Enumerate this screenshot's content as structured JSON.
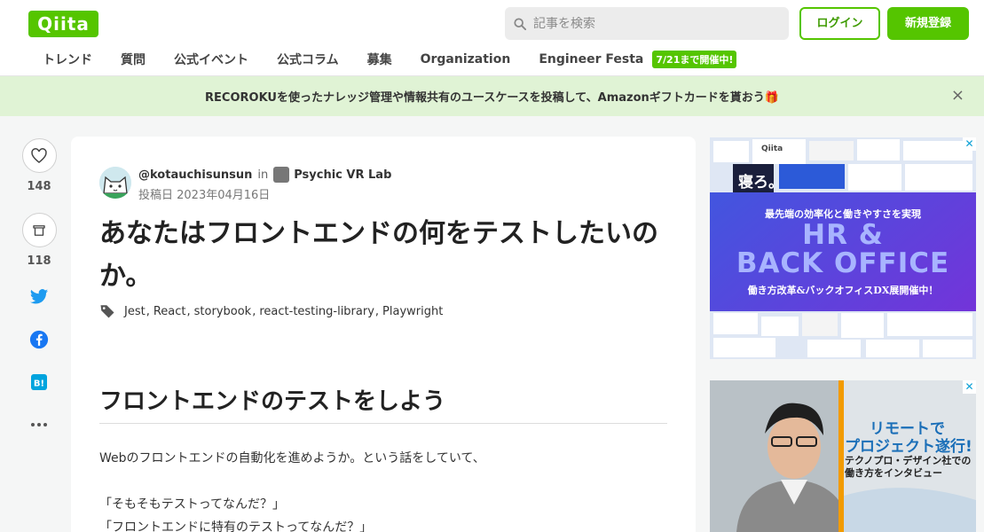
{
  "header": {
    "logo": "Qiita",
    "search_placeholder": "記事を検索",
    "login_label": "ログイン",
    "signup_label": "新規登録",
    "nav": [
      "トレンド",
      "質問",
      "公式イベント",
      "公式コラム",
      "募集",
      "Organization",
      "Engineer Festa"
    ],
    "nav_badge": "7/21まで開催中!"
  },
  "banner": {
    "text": "RECOROKUを使ったナレッジ管理や情報共有のユースケースを投稿して、Amazonギフトカードを貰おう🎁",
    "close": "×"
  },
  "actions": {
    "like_count": "148",
    "stock_count": "118"
  },
  "article": {
    "author": "@kotauchisunsun",
    "in_text": "in",
    "organization": "Psychic VR Lab",
    "posted_date": "投稿日 2023年04月16日",
    "title": "あなたはフロントエンドの何をテストしたいのか。",
    "tags": [
      "Jest",
      "React",
      "storybook",
      "react-testing-library",
      "Playwright"
    ],
    "heading": "フロントエンドのテストをしよう",
    "paragraphs": [
      "Webのフロントエンドの自動化を進めようか。という話をしていて、",
      "「そもそもテストってなんだ？」",
      "「フロントエンドに特有のテストってなんだ？」"
    ]
  },
  "ads": {
    "ad1": {
      "tagline": "最先端の効率化と働きやすさを実現",
      "line1": "HR &",
      "line2": "BACK OFFICE",
      "line3": "働き方改革&バックオフィスDX展開催中！",
      "small_logo": "Qiita",
      "sleep": "寝ろ。"
    },
    "ad2": {
      "line1": "リモートで",
      "line2": "プロジェクト遂行!",
      "line3": "テクノプロ・デザイン社での",
      "line4": "働き方をインタビュー"
    }
  },
  "colors": {
    "brand": "#55c500",
    "banner_bg": "#e0f3d5"
  }
}
